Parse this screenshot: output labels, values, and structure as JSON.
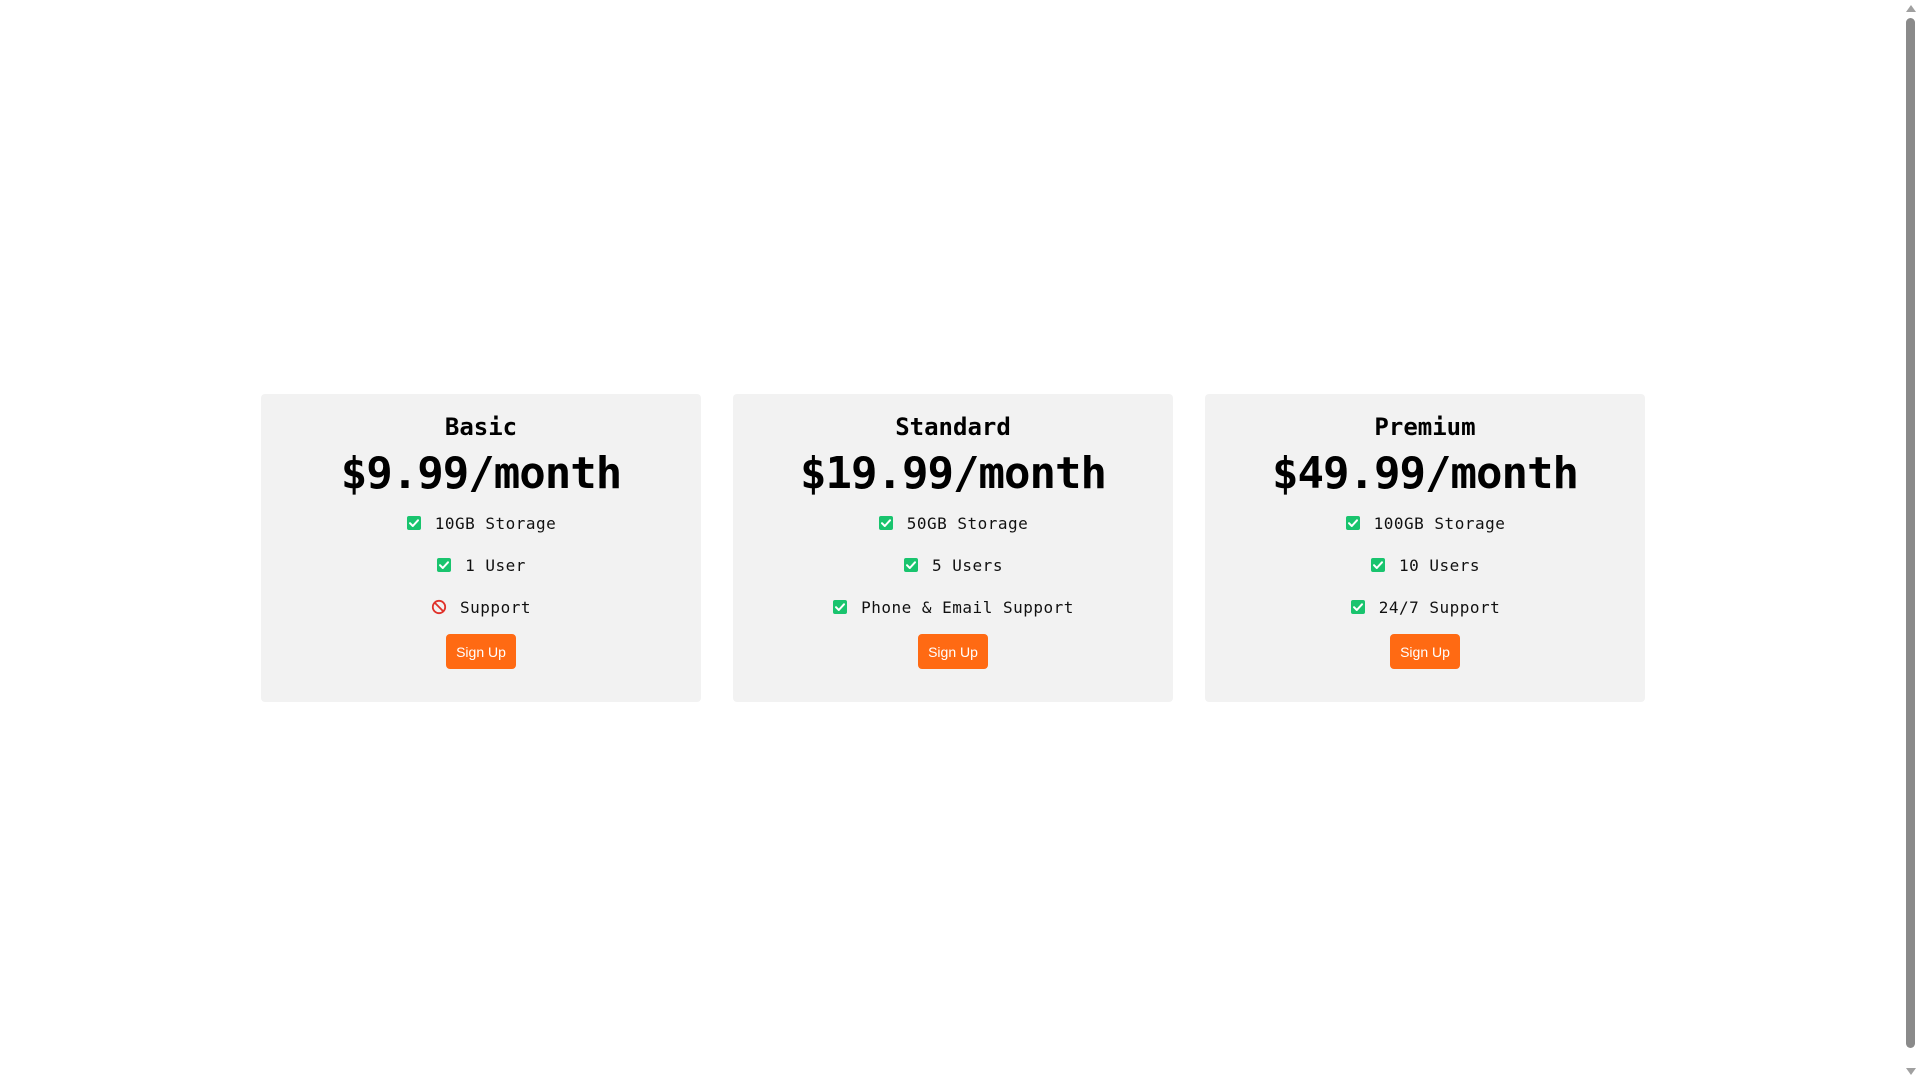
{
  "colors": {
    "card_background": "#f2f2f2",
    "button": "#ff6a13",
    "check": "#19c46e",
    "cross": "#e0322b"
  },
  "plans": [
    {
      "name": "Basic",
      "price": "$9.99/month",
      "features": [
        {
          "text": "10GB Storage",
          "icon": "check-icon"
        },
        {
          "text": "1 User",
          "icon": "check-icon"
        },
        {
          "text": "Support",
          "icon": "prohibited-icon"
        }
      ],
      "button_label": "Sign Up"
    },
    {
      "name": "Standard",
      "price": "$19.99/month",
      "features": [
        {
          "text": "50GB Storage",
          "icon": "check-icon"
        },
        {
          "text": "5 Users",
          "icon": "check-icon"
        },
        {
          "text": "Phone & Email Support",
          "icon": "check-icon"
        }
      ],
      "button_label": "Sign Up"
    },
    {
      "name": "Premium",
      "price": "$49.99/month",
      "features": [
        {
          "text": "100GB Storage",
          "icon": "check-icon"
        },
        {
          "text": "10 Users",
          "icon": "check-icon"
        },
        {
          "text": "24/7 Support",
          "icon": "check-icon"
        }
      ],
      "button_label": "Sign Up"
    }
  ]
}
